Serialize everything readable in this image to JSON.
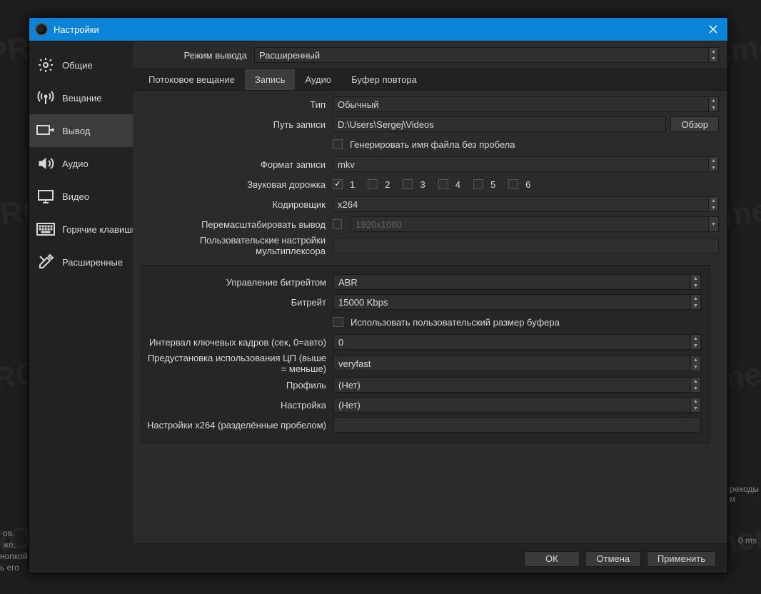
{
  "window": {
    "title": "Настройки"
  },
  "sidebar": {
    "items": [
      {
        "label": "Общие",
        "icon": "gear"
      },
      {
        "label": "Вещание",
        "icon": "antenna"
      },
      {
        "label": "Вывод",
        "icon": "output",
        "active": true
      },
      {
        "label": "Аудио",
        "icon": "speaker"
      },
      {
        "label": "Видео",
        "icon": "monitor"
      },
      {
        "label": "Горячие клавиши",
        "icon": "keyboard"
      },
      {
        "label": "Расширенные",
        "icon": "tools"
      }
    ]
  },
  "output_mode": {
    "label": "Режим вывода",
    "value": "Расширенный"
  },
  "tabs": [
    {
      "label": "Потоковое вещание"
    },
    {
      "label": "Запись",
      "active": true
    },
    {
      "label": "Аудио"
    },
    {
      "label": "Буфер повтора"
    }
  ],
  "recording": {
    "type_label": "Тип",
    "type_value": "Обычный",
    "path_label": "Путь записи",
    "path_value": "D:\\Users\\Sergej\\Videos",
    "browse_btn": "Обзор",
    "nospace_cb": "Генерировать имя файла без пробела",
    "nospace_checked": false,
    "format_label": "Формат записи",
    "format_value": "mkv",
    "track_label": "Звуковая дорожка",
    "tracks": [
      {
        "n": "1",
        "checked": true
      },
      {
        "n": "2",
        "checked": false
      },
      {
        "n": "3",
        "checked": false
      },
      {
        "n": "4",
        "checked": false
      },
      {
        "n": "5",
        "checked": false
      },
      {
        "n": "6",
        "checked": false
      }
    ],
    "encoder_label": "Кодировщик",
    "encoder_value": "x264",
    "rescale_label": "Перемасштабировать вывод",
    "rescale_checked": false,
    "rescale_value": "1920x1080",
    "mux_label": "Пользовательские настройки мультиплексора",
    "mux_value": ""
  },
  "encoder": {
    "rc_label": "Управление битрейтом",
    "rc_value": "ABR",
    "bitrate_label": "Битрейт",
    "bitrate_value": "15000 Kbps",
    "custom_buf_label": "Использовать пользовательский размер буфера",
    "custom_buf_checked": false,
    "keyint_label": "Интервал ключевых кадров (сек, 0=авто)",
    "keyint_value": "0",
    "preset_label": "Предустановка использования ЦП (выше = меньше)",
    "preset_value": "veryfast",
    "profile_label": "Профиль",
    "profile_value": "(Нет)",
    "tune_label": "Настройка",
    "tune_value": "(Нет)",
    "x264opts_label": "Настройки x264 (разделённые пробелом)",
    "x264opts_value": ""
  },
  "footer": {
    "ok": "ОК",
    "cancel": "Отмена",
    "apply": "Применить"
  },
  "background": {
    "frag1": "ов.",
    "frag2": "же,",
    "frag3": "нопкой",
    "frag4": "ь его",
    "frag5": "реходы м",
    "frag6": "0 ms"
  }
}
